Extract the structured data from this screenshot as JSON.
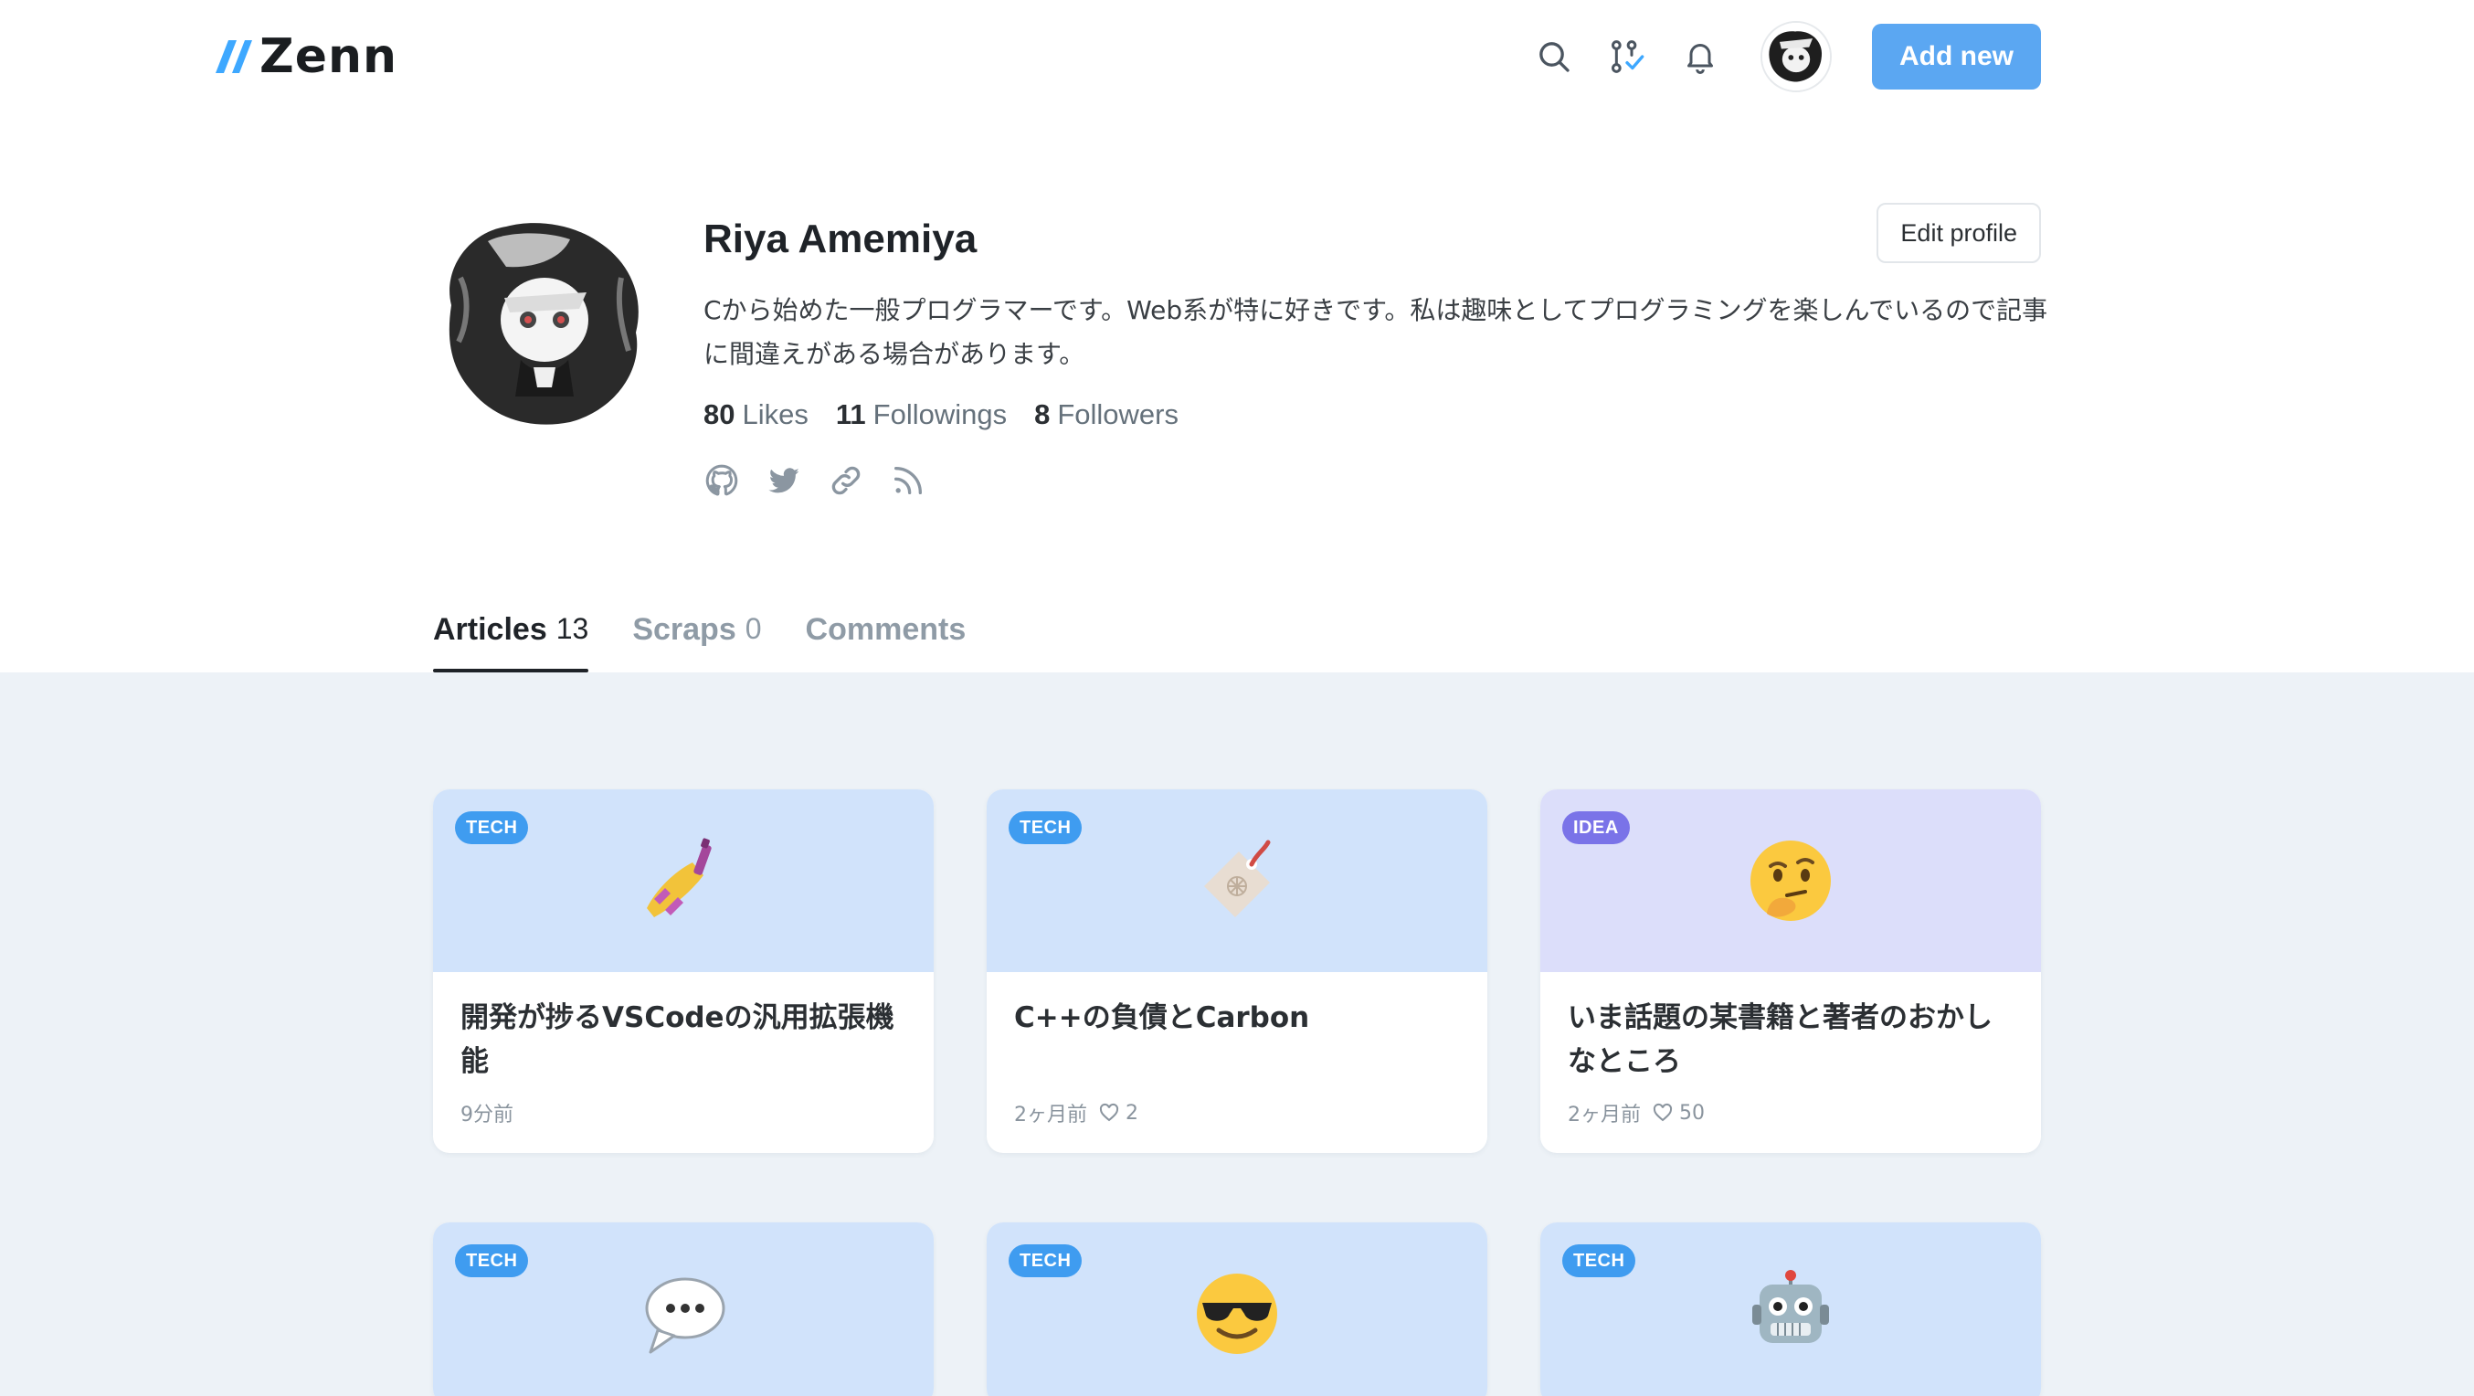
{
  "header": {
    "logo_text": "Zenn",
    "add_new_label": "Add new"
  },
  "profile": {
    "name": "Riya Amemiya",
    "bio": "Cから始めた一般プログラマーです。Web系が特に好きです。私は趣味としてプログラミングを楽しんでいるので記事に間違えがある場合があります。",
    "edit_label": "Edit profile",
    "stats": [
      {
        "num": "80",
        "label": "Likes"
      },
      {
        "num": "11",
        "label": "Followings"
      },
      {
        "num": "8",
        "label": "Followers"
      }
    ]
  },
  "tabs": [
    {
      "label": "Articles",
      "count": "13"
    },
    {
      "label": "Scraps",
      "count": "0"
    },
    {
      "label": "Comments",
      "count": ""
    }
  ],
  "articles": [
    {
      "type": "TECH",
      "emoji": "nail-polish-icon",
      "title": "開発が捗るVSCodeの汎用拡張機能",
      "date": "9分前",
      "likes": ""
    },
    {
      "type": "TECH",
      "emoji": "label-tag-icon",
      "title": "C++の負債とCarbon",
      "date": "2ヶ月前",
      "likes": "2"
    },
    {
      "type": "IDEA",
      "emoji": "thinking-face-icon",
      "title": "いま話題の某書籍と著者のおかしなところ",
      "date": "2ヶ月前",
      "likes": "50"
    },
    {
      "type": "TECH",
      "emoji": "speech-balloon-icon",
      "title": "",
      "date": "",
      "likes": ""
    },
    {
      "type": "TECH",
      "emoji": "sunglasses-face-icon",
      "title": "",
      "date": "",
      "likes": ""
    },
    {
      "type": "TECH",
      "emoji": "robot-face-icon",
      "title": "",
      "date": "",
      "likes": ""
    }
  ],
  "colors": {
    "accent": "#5ba7f2",
    "tech_badge": "#3f9cf0",
    "idea_badge": "#7a73e8",
    "tech_bg": "#d1e3fb",
    "idea_bg": "#dcdefa",
    "page_bg": "#edf2f7"
  }
}
